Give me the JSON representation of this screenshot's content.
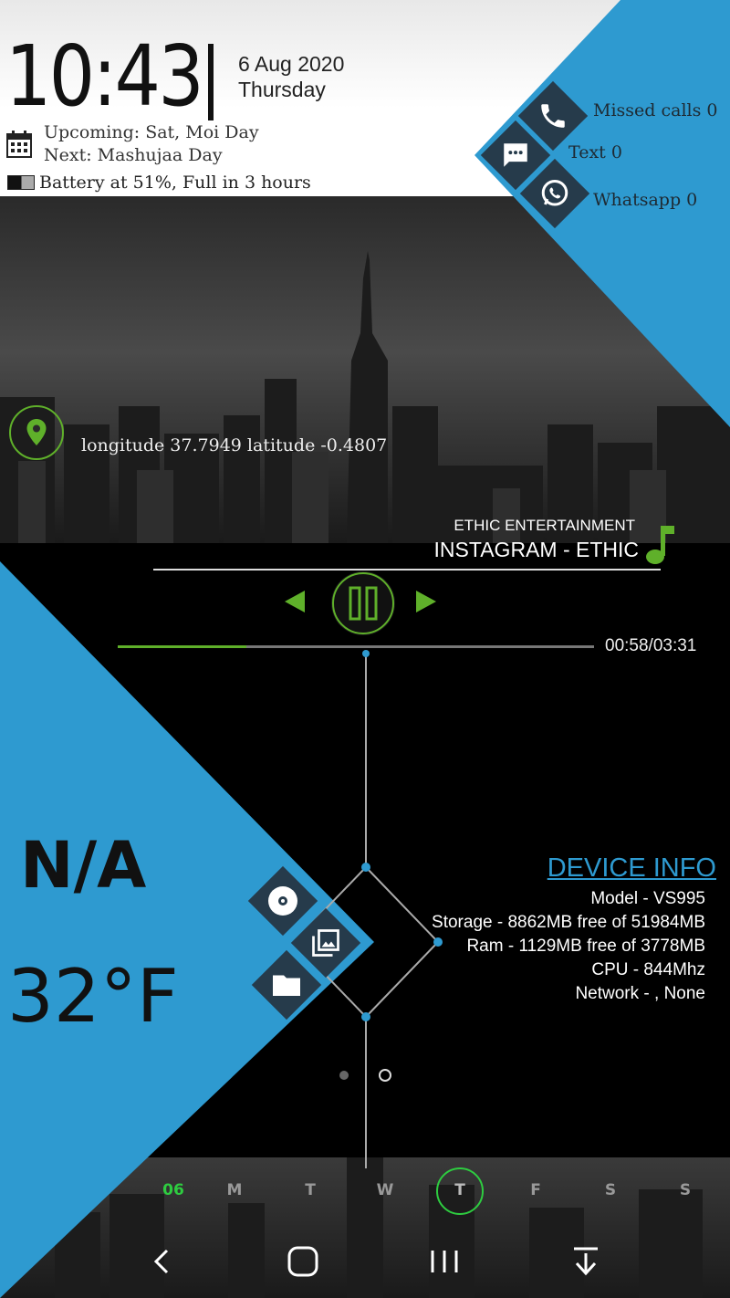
{
  "clock": {
    "time": "10:43",
    "date": "6 Aug 2020",
    "weekday": "Thursday"
  },
  "events": {
    "upcoming": "Upcoming: Sat, Moi Day",
    "next": "Next: Mashujaa Day"
  },
  "battery": {
    "level": 0.51,
    "text": "Battery at 51%, Full in 3 hours"
  },
  "comms": {
    "missed_calls": "Missed calls 0",
    "text": "Text 0",
    "whatsapp": "Whatsapp 0"
  },
  "location": {
    "text": "longitude 37.7949 latitude -0.4807"
  },
  "music": {
    "artist": "ETHIC ENTERTAINMENT",
    "title": "INSTAGRAM - ETHIC",
    "progress": 0.27,
    "time": "00:58/03:31"
  },
  "weather": {
    "condition": "N/A",
    "temperature": "32°F"
  },
  "device_info": {
    "title": "DEVICE INFO",
    "model": "Model - VS995",
    "storage": "Storage - 8862MB free of 51984MB",
    "ram": "Ram - 1129MB free of 3778MB",
    "cpu": "CPU - 844Mhz",
    "network": "Network - , None"
  },
  "weekdays": [
    "06",
    "M",
    "T",
    "W",
    "T",
    "F",
    "S",
    "S"
  ],
  "weekday_selected_index": 4,
  "icons": {
    "calendar": "calendar-icon",
    "phone": "phone-icon",
    "message": "message-icon",
    "whatsapp": "whatsapp-icon",
    "location": "location-pin-icon",
    "music_note": "music-note-icon",
    "music_disc": "disc-icon",
    "gallery": "gallery-icon",
    "folder": "folder-icon"
  },
  "colors": {
    "accent_blue": "#2e9ad0",
    "accent_green": "#5fb02a",
    "diamond_dark": "#263b4b"
  }
}
